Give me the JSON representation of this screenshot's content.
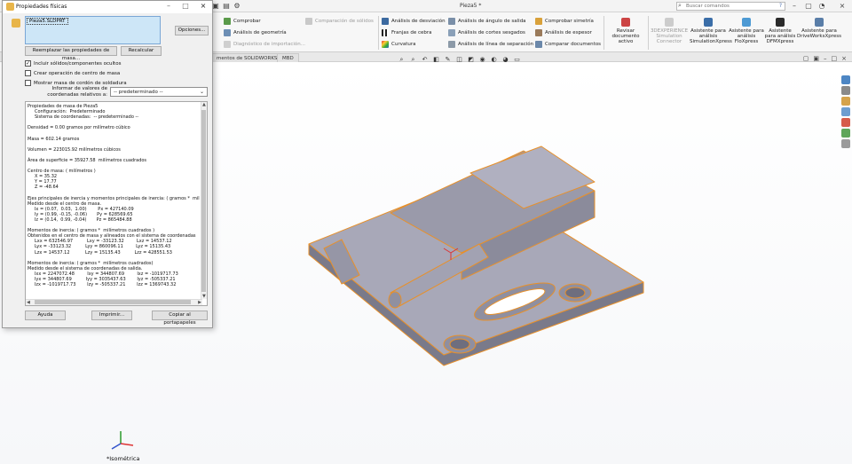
{
  "app": {
    "doc_title": "Pieza5 *",
    "search_placeholder": "Buscar comandos"
  },
  "ribbon": {
    "items": [
      {
        "label": "Comprobar",
        "dim": false
      },
      {
        "label": "Comparación de sólidos",
        "dim": true
      },
      {
        "label": "Análisis de geometría",
        "dim": false
      },
      {
        "label": "Diagnóstico de importación...",
        "dim": true
      },
      {
        "label": "Análisis de desviación",
        "dim": false
      },
      {
        "label": "Franjas de cebra",
        "dim": false
      },
      {
        "label": "Curvatura",
        "dim": false
      },
      {
        "label": "Análisis de ángulo de salida",
        "dim": false
      },
      {
        "label": "Análisis de cortes sesgados",
        "dim": false
      },
      {
        "label": "Análisis de línea de separación",
        "dim": false
      },
      {
        "label": "Comprobar simetría",
        "dim": false
      },
      {
        "label": "Análisis de espesor",
        "dim": false
      },
      {
        "label": "Comparar documentos",
        "dim": false
      }
    ],
    "big": [
      {
        "label": "Revisar documento activo",
        "dim": false
      },
      {
        "label": "3DEXPERIENCE Simulation Connector",
        "dim": true
      },
      {
        "label": "Asistente para análisis SimulationXpress",
        "dim": false
      },
      {
        "label": "Asistente para análisis FloXpress",
        "dim": false
      },
      {
        "label": "Asistente para análisis DFMXpress",
        "dim": false
      },
      {
        "label": "Asistente para DriveWorksXpress",
        "dim": false
      }
    ]
  },
  "tabs": [
    "mentos de SOLIDWORKS",
    "MBD"
  ],
  "viewport": {
    "view_label": "*Isométrica"
  },
  "dialog": {
    "title": "Propiedades físicas",
    "file_item": "Pieza5.SLDPRT",
    "options_btn": "Opciones...",
    "override_btn": "Reemplazar las propiedades de masa...",
    "recalc_btn": "Recalcular",
    "chk_include": "Incluir sólidos/componentes ocultos",
    "chk_include_checked": true,
    "chk_center": "Crear operación de centro de masa",
    "chk_center_checked": false,
    "chk_weld": "Mostrar masa de cordón de soldadura",
    "chk_weld_checked": false,
    "relative_label": "Informar de valores de coordenadas relativos a:",
    "relative_value": "-- predeterminado --",
    "help_btn": "Ayuda",
    "print_btn": "Imprimir...",
    "copy_btn": "Copiar al portapapeles",
    "results": [
      "Propiedades de masa de Pieza5",
      "     Configuración:  Predeterminado",
      "     Sistema de coordenadas:  -- predeterminado --",
      "",
      "Densidad = 0.00 gramos por milímetro cúbico",
      "",
      "Masa = 602.14 gramos",
      "",
      "Volumen = 223015.92 milímetros cúbicos",
      "",
      "Área de superficie = 35927.58  milímetros cuadrados",
      "",
      "Centro de masa: ( milímetros )",
      "     X = 35.32",
      "     Y = 17.77",
      "     Z = -48.64",
      "",
      "Ejes principales de inercia y momentos principales de inercia: ( gramos *  mil",
      "Medido desde el centro de masa.",
      "     Ix = (0.07,  0.03,  1.00)        Px = 427140.09",
      "     Iy = (0.99, -0.15, -0.06)       Py = 628569.65",
      "     Iz = (0.14,  0.99, -0.04)       Pz = 865484.88",
      "",
      "Momentos de inercia: ( gramos *  milímetros cuadrados )",
      "Obtenidos en el centro de masa y alineados con el sistema de coordenadas",
      "     Lxx = 632546.97          Lxy = -33123.32         Lxz = 14537.12",
      "     Lyx = -33123.32          Lyy = 860096.11         Lyz = 15135.43",
      "     Lzx = 14537.12           Lzy = 15135.43          Lzz = 428551.53",
      "",
      "Momentos de inercia: ( gramos *  milímetros cuadrados)",
      "Medido desde el sistema de coordenadas de salida.",
      "     Ixx = 2247072.48         Ixy = 344807.69         Ixz = -1019717.73",
      "     Iyx = 344807.69          Iyy = 3035437.63        Iyz = -505337.21",
      "     Izx = -1019717.73        Izy = -505337.21        Izz = 1369743.32"
    ]
  },
  "colors": {
    "edge": "#e8902a",
    "face_top": "#a9a9b8",
    "face_side": "#7c7c8c",
    "selection": "#cde6f7"
  }
}
